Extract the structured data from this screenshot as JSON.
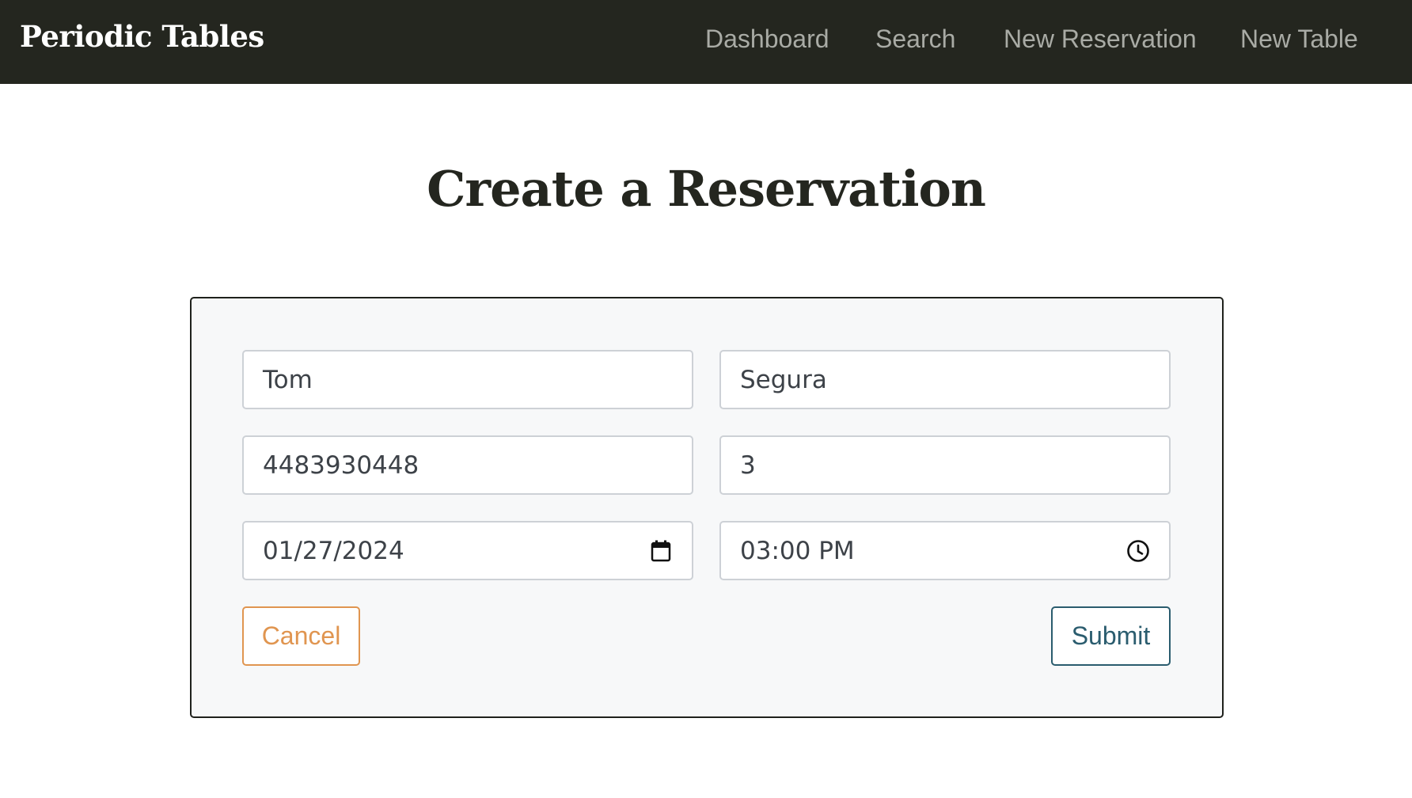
{
  "navbar": {
    "brand": "Periodic Tables",
    "links": [
      {
        "label": "Dashboard"
      },
      {
        "label": "Search"
      },
      {
        "label": "New Reservation"
      },
      {
        "label": "New Table"
      }
    ],
    "background_color": "#24261f",
    "link_color": "#a9aba5"
  },
  "page": {
    "title": "Create a Reservation"
  },
  "form": {
    "first_name": {
      "value": "Tom"
    },
    "last_name": {
      "value": "Segura"
    },
    "mobile_number": {
      "value": "4483930448"
    },
    "people": {
      "value": "3"
    },
    "reservation_date": {
      "value": "01/27/2024",
      "icon": "calendar-icon"
    },
    "reservation_time": {
      "value": "03:00 PM",
      "icon": "clock-icon"
    },
    "cancel_label": "Cancel",
    "submit_label": "Submit",
    "colors": {
      "cancel": "#e09550",
      "submit": "#2a5c6e",
      "card_background": "#f7f8f9"
    }
  }
}
